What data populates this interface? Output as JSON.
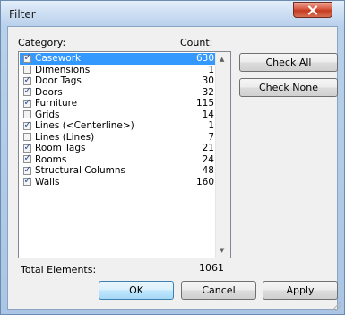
{
  "window": {
    "title": "Filter"
  },
  "list": {
    "category_header": "Category:",
    "count_header": "Count:",
    "items": [
      {
        "name": "Casework",
        "count": "630",
        "checked": true,
        "selected": true
      },
      {
        "name": "Dimensions",
        "count": "1",
        "checked": false,
        "selected": false
      },
      {
        "name": "Door Tags",
        "count": "30",
        "checked": true,
        "selected": false
      },
      {
        "name": "Doors",
        "count": "32",
        "checked": true,
        "selected": false
      },
      {
        "name": "Furniture",
        "count": "115",
        "checked": true,
        "selected": false
      },
      {
        "name": "Grids",
        "count": "14",
        "checked": false,
        "selected": false
      },
      {
        "name": "Lines (<Centerline>)",
        "count": "1",
        "checked": true,
        "selected": false
      },
      {
        "name": "Lines (Lines)",
        "count": "7",
        "checked": false,
        "selected": false
      },
      {
        "name": "Room Tags",
        "count": "21",
        "checked": true,
        "selected": false
      },
      {
        "name": "Rooms",
        "count": "24",
        "checked": true,
        "selected": false
      },
      {
        "name": "Structural Columns",
        "count": "48",
        "checked": true,
        "selected": false
      },
      {
        "name": "Walls",
        "count": "160",
        "checked": true,
        "selected": false
      }
    ]
  },
  "side_buttons": {
    "check_all": "Check All",
    "check_none": "Check None"
  },
  "totals": {
    "label": "Total Elements:",
    "value": "1061"
  },
  "footer": {
    "ok": "OK",
    "cancel": "Cancel",
    "apply": "Apply"
  },
  "icons": {
    "close": "close-icon",
    "scroll_up": "scroll-up-arrow-icon",
    "scroll_down": "scroll-down-arrow-icon",
    "checkbox": "checkmark-icon"
  },
  "colors": {
    "selection": "#3399ff",
    "close_button": "#c94a30",
    "default_button_border": "#3c7fb1"
  }
}
